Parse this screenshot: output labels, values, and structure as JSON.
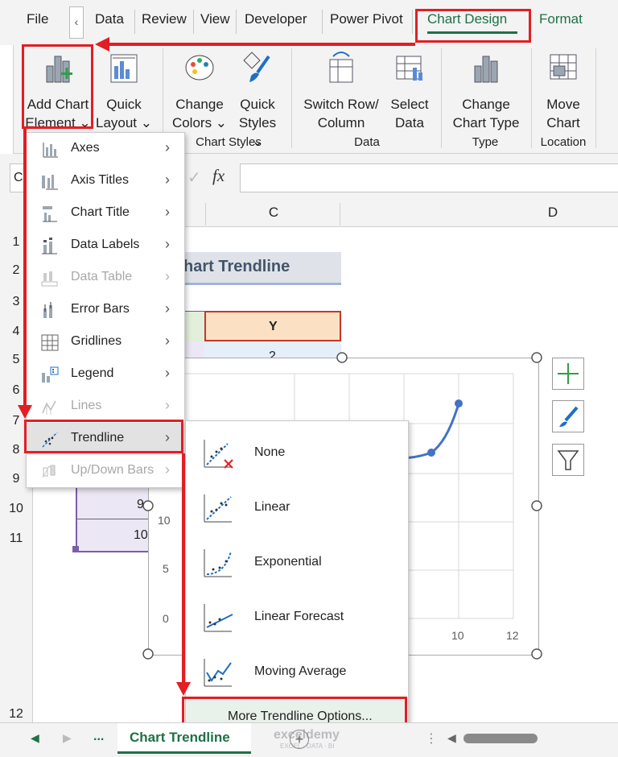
{
  "tabs": [
    "File",
    "Data",
    "Review",
    "View",
    "Developer",
    "Power Pivot",
    "Chart Design",
    "Format"
  ],
  "tab_scroll_glyph": "‹",
  "ribbon": {
    "add_chart_element": [
      "Add Chart",
      "Element ⌄"
    ],
    "quick_layout": [
      "Quick",
      "Layout ⌄"
    ],
    "change_colors": [
      "Change",
      "Colors ⌄"
    ],
    "quick_styles": [
      "Quick",
      "Styles ⌄"
    ],
    "switch_row_column": [
      "Switch Row/",
      "Column"
    ],
    "select_data": [
      "Select",
      "Data"
    ],
    "change_chart_type": [
      "Change",
      "Chart Type"
    ],
    "move_chart": [
      "Move",
      "Chart"
    ],
    "groups": [
      "Chart Styles",
      "Data",
      "Type",
      "Location"
    ]
  },
  "formula_bar": {
    "name_box_partial": "C",
    "fx": "fx",
    "cancel_glyph": "✓"
  },
  "columns": [
    "C",
    "D"
  ],
  "rows": [
    "1",
    "2",
    "3",
    "4",
    "5",
    "6",
    "7",
    "8",
    "9",
    "10",
    "11",
    "12"
  ],
  "sheet": {
    "title_partial": "hart Trendline",
    "header_y": "Y",
    "value_y_row5": "2",
    "cell_b10": "9",
    "cell_b11": "10"
  },
  "chart": {
    "y_ticks": [
      "10",
      "5",
      "0"
    ],
    "x_ticks": [
      "10",
      "12"
    ]
  },
  "menu": {
    "items": [
      {
        "label": "Axes",
        "enabled": true
      },
      {
        "label": "Axis Titles",
        "enabled": true
      },
      {
        "label": "Chart Title",
        "enabled": true
      },
      {
        "label": "Data Labels",
        "enabled": true
      },
      {
        "label": "Data Table",
        "enabled": false
      },
      {
        "label": "Error Bars",
        "enabled": true
      },
      {
        "label": "Gridlines",
        "enabled": true
      },
      {
        "label": "Legend",
        "enabled": true
      },
      {
        "label": "Lines",
        "enabled": false
      },
      {
        "label": "Trendline",
        "enabled": true
      },
      {
        "label": "Up/Down Bars",
        "enabled": false
      }
    ],
    "arrow": "›"
  },
  "submenu": {
    "items": [
      "None",
      "Linear",
      "Exponential",
      "Linear Forecast",
      "Moving Average"
    ],
    "more": "More Trendline Options..."
  },
  "status": {
    "sheet_tab": "Chart Trendline",
    "ellipsis": "...",
    "watermark": "exceldemy",
    "watermark_sub": "EXCEL · DATA · BI"
  },
  "colors": {
    "accent": "#1e7145",
    "highlight": "#e31e24",
    "series": "#4472c4"
  }
}
